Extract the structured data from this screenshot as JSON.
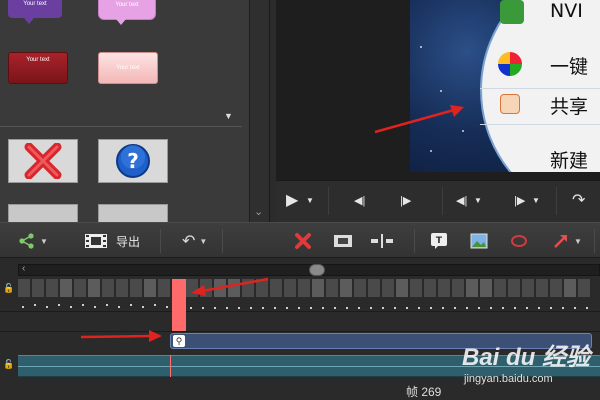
{
  "library": {
    "callouts": [
      "Your text",
      "Your text",
      "Your text",
      "Your text"
    ],
    "dropdown_icon": "triangle-down"
  },
  "preview": {
    "menu_items": [
      "NVI",
      "一键",
      "共享",
      "新建"
    ]
  },
  "toolbar": {
    "export_label": "导出"
  },
  "timeline": {
    "frame_label": "帧 269"
  },
  "colors": {
    "playhead": "#ff6b6b",
    "annotation_arrow": "#e0231f",
    "clip": "#3c4f74",
    "audio": "#2f5f6c"
  },
  "watermark": {
    "brand": "Bai du 经验",
    "url": "jingyan.baidu.com"
  }
}
